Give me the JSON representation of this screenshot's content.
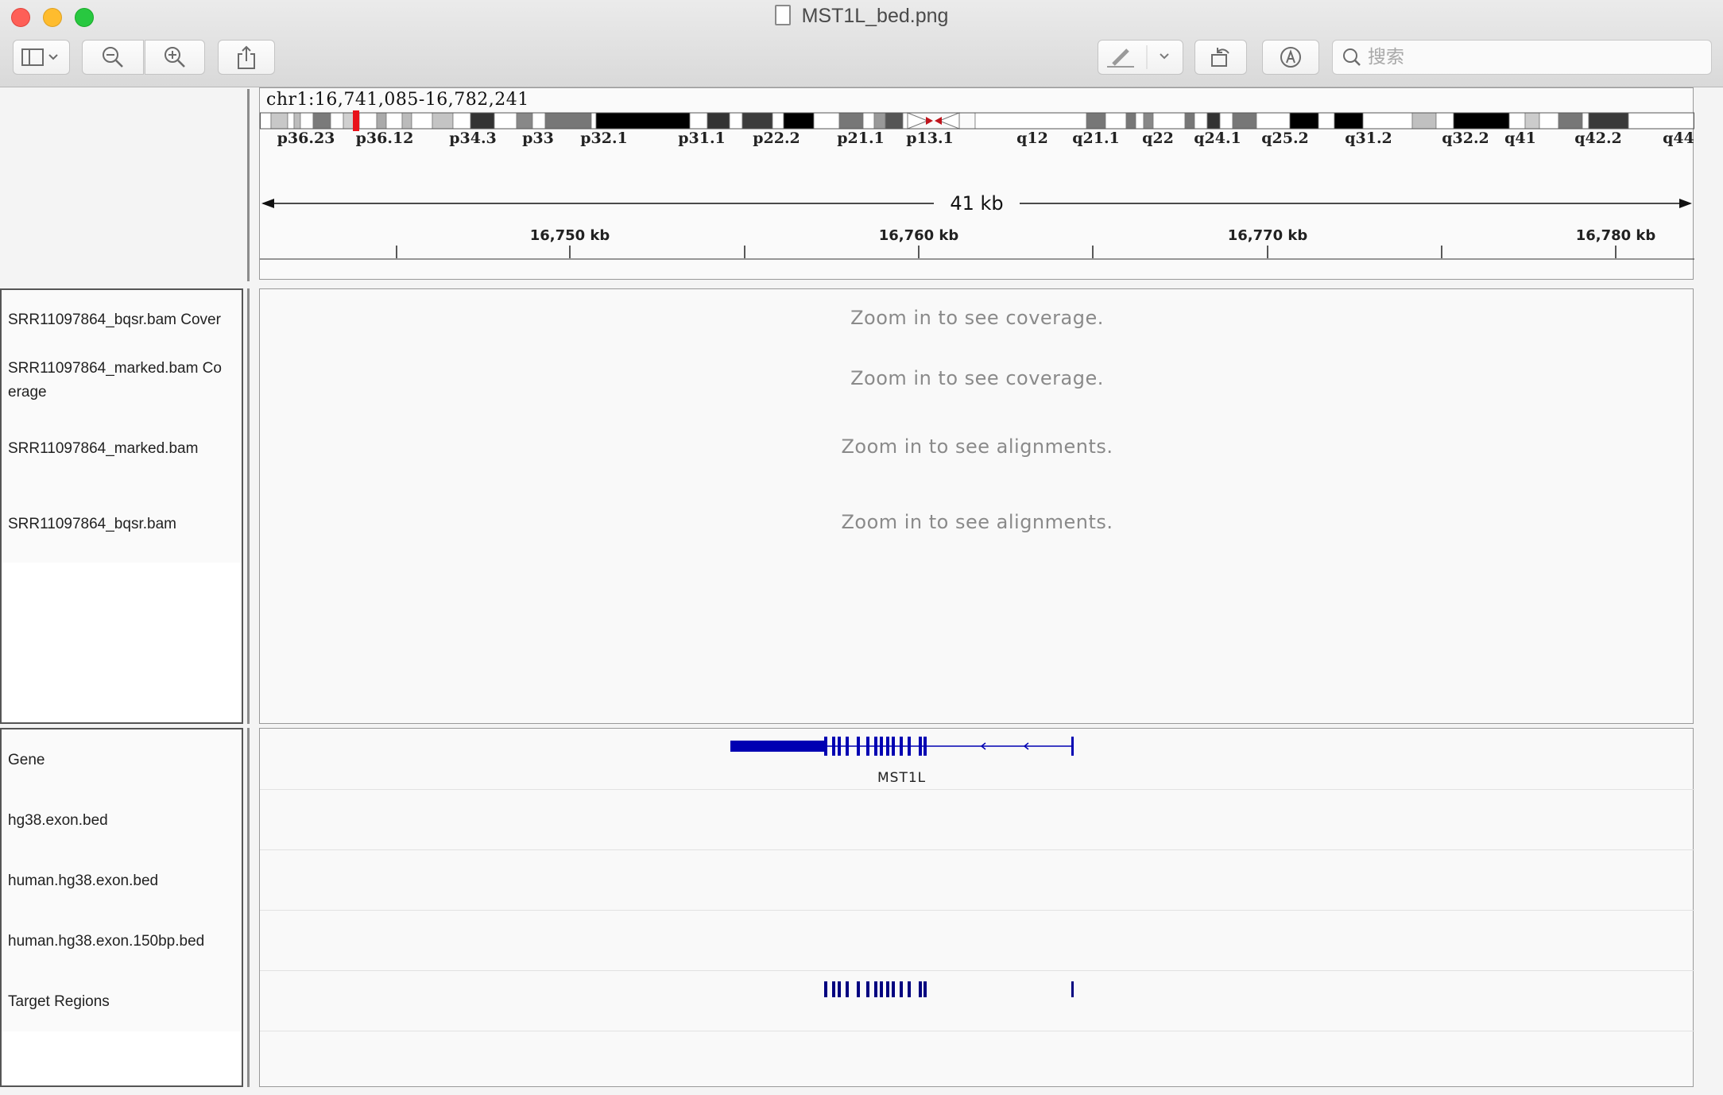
{
  "window": {
    "title": "MST1L_bed.png"
  },
  "toolbar": {
    "buttons": [
      {
        "name": "sidebar-toggle-button",
        "icon": "sidebar-icon"
      },
      {
        "name": "zoom-out-button",
        "icon": "zoom-out-icon"
      },
      {
        "name": "zoom-in-button",
        "icon": "zoom-in-icon"
      },
      {
        "name": "share-button",
        "icon": "share-icon"
      },
      {
        "name": "markup-pen-button",
        "icon": "pen-icon"
      },
      {
        "name": "rotate-button",
        "icon": "rotate-icon"
      },
      {
        "name": "markup-button",
        "icon": "markup-icon"
      }
    ],
    "search_placeholder": "搜索"
  },
  "igv": {
    "locus": "chr1:16,741,085-16,782,241",
    "bands": [
      "p36.23",
      "p36.12",
      "p34.3",
      "p33",
      "p32.1",
      "p31.1",
      "p22.2",
      "p21.1",
      "p13.1",
      "q12",
      "q21.1",
      "q22",
      "q24.1",
      "q25.2",
      "q31.2",
      "q32.2",
      "q41",
      "q42.2",
      "q44"
    ],
    "span_label": "41 kb",
    "ruler_ticks": [
      "16,750 kb",
      "16,760 kb",
      "16,770 kb",
      "16,780 kb"
    ],
    "alignment_tracks": [
      {
        "name": "SRR11097864_bqsr.bam Cover",
        "message": "Zoom in to see coverage."
      },
      {
        "name": "SRR11097864_marked.bam Co",
        "name2": "erage",
        "message": "Zoom in to see coverage."
      },
      {
        "name": "SRR11097864_marked.bam",
        "message": "Zoom in to see alignments."
      },
      {
        "name": "SRR11097864_bqsr.bam",
        "message": "Zoom in to see alignments."
      }
    ],
    "feature_tracks": [
      {
        "name": "Gene"
      },
      {
        "name": "hg38.exon.bed"
      },
      {
        "name": "human.hg38.exon.bed"
      },
      {
        "name": "human.hg38.exon.150bp.bed"
      },
      {
        "name": "Target Regions"
      }
    ],
    "gene_label": "MST1L",
    "colors": {
      "gene": "#0000b2",
      "target": "#000080",
      "highlight": "#e8121a"
    }
  }
}
